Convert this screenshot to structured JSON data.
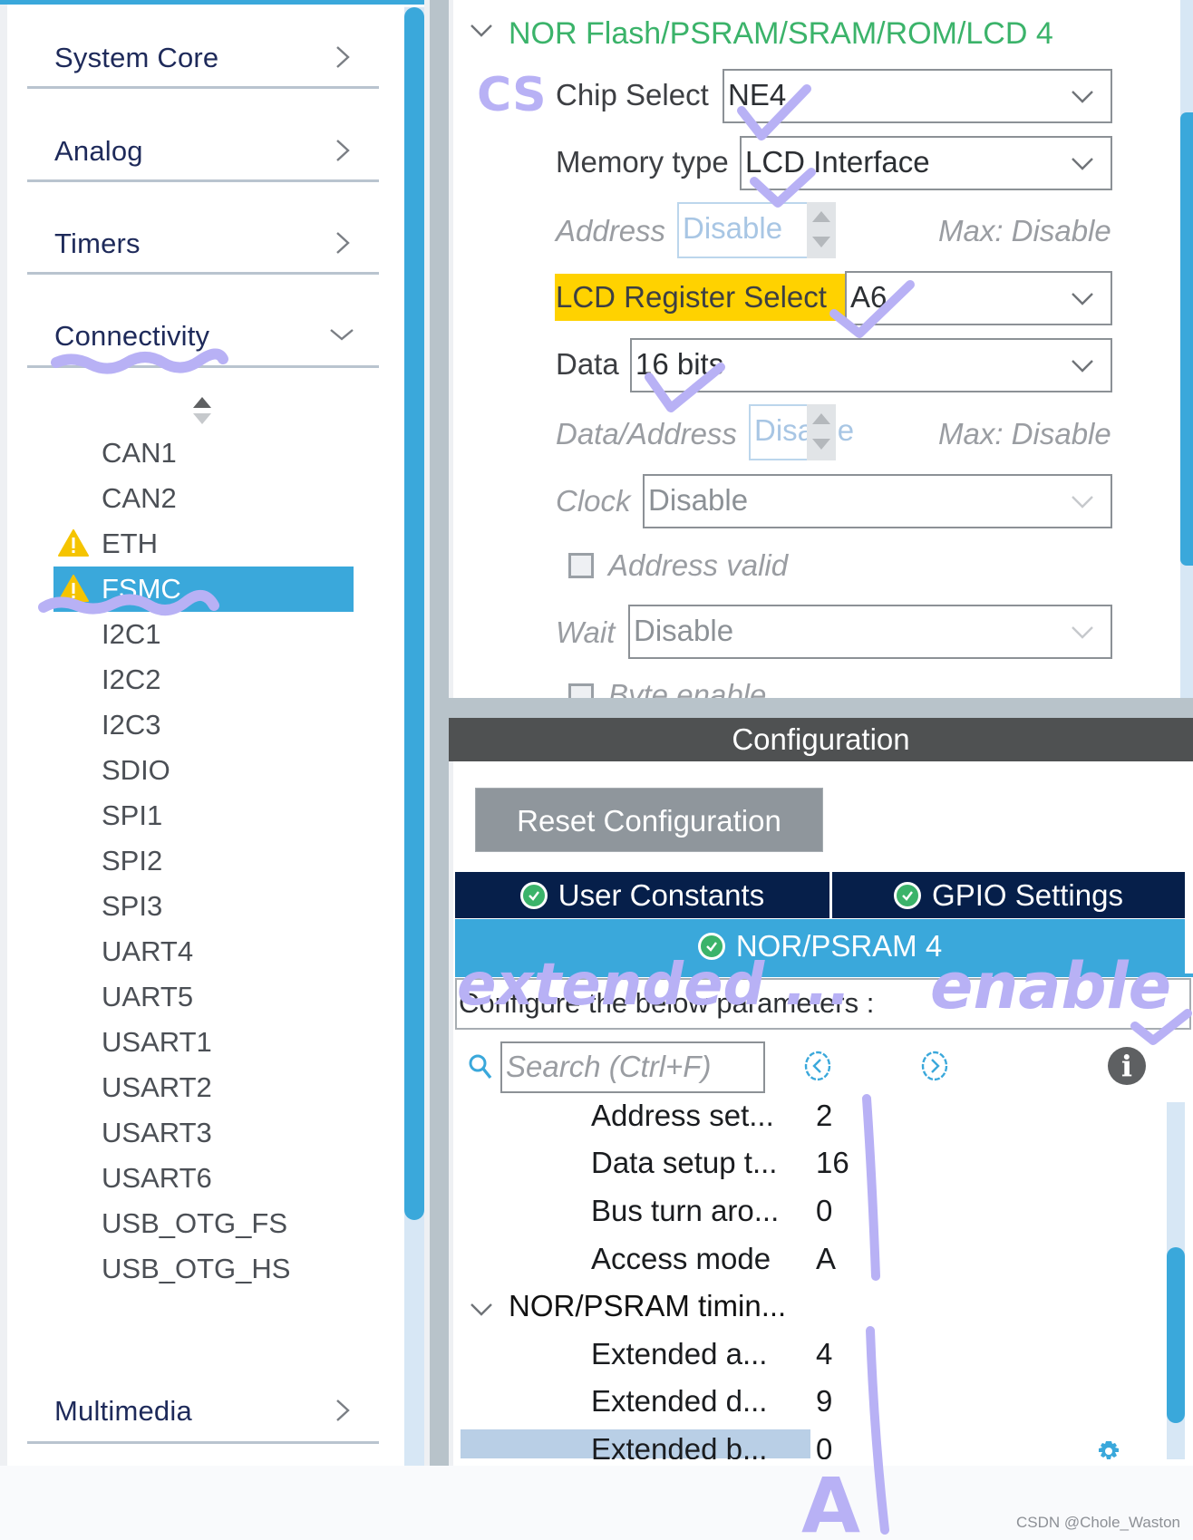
{
  "sidebar": {
    "categories": [
      {
        "label": "System Core",
        "icon": "chevron-right-icon"
      },
      {
        "label": "Analog",
        "icon": "chevron-right-icon"
      },
      {
        "label": "Timers",
        "icon": "chevron-right-icon"
      },
      {
        "label": "Connectivity",
        "icon": "chevron-down-icon",
        "expanded": true
      },
      {
        "label": "Multimedia",
        "icon": "chevron-right-icon"
      }
    ],
    "sort_icon": "sort-arrows-icon",
    "connectivity_items": [
      {
        "label": "CAN1",
        "warning": false
      },
      {
        "label": "CAN2",
        "warning": false
      },
      {
        "label": "ETH",
        "warning": true
      },
      {
        "label": "FSMC",
        "warning": true,
        "selected": true
      },
      {
        "label": "I2C1",
        "warning": false
      },
      {
        "label": "I2C2",
        "warning": false
      },
      {
        "label": "I2C3",
        "warning": false
      },
      {
        "label": "SDIO",
        "warning": false
      },
      {
        "label": "SPI1",
        "warning": false
      },
      {
        "label": "SPI2",
        "warning": false
      },
      {
        "label": "SPI3",
        "warning": false
      },
      {
        "label": "UART4",
        "warning": false
      },
      {
        "label": "UART5",
        "warning": false
      },
      {
        "label": "USART1",
        "warning": false
      },
      {
        "label": "USART2",
        "warning": false
      },
      {
        "label": "USART3",
        "warning": false
      },
      {
        "label": "USART6",
        "warning": false
      },
      {
        "label": "USB_OTG_FS",
        "warning": false
      },
      {
        "label": "USB_OTG_HS",
        "warning": false
      }
    ]
  },
  "mode": {
    "section_title": "NOR Flash/PSRAM/SRAM/ROM/LCD 4",
    "chip_select": {
      "label": "Chip Select",
      "value": "NE4"
    },
    "memory_type": {
      "label": "Memory type",
      "value": "LCD Interface"
    },
    "address": {
      "label": "Address",
      "value": "Disable",
      "max": "Max: Disable"
    },
    "lcd_register_select": {
      "label": "LCD Register Select",
      "value": "A6"
    },
    "data": {
      "label": "Data",
      "value": "16 bits"
    },
    "data_address": {
      "label": "Data/Address",
      "value": "Disable",
      "max": "Max: Disable"
    },
    "clock": {
      "label": "Clock",
      "value": "Disable"
    },
    "address_valid": {
      "label": "Address valid",
      "checked": false
    },
    "wait": {
      "label": "Wait",
      "value": "Disable"
    },
    "byte_enable": {
      "label": "Byte enable",
      "checked": false
    }
  },
  "configuration": {
    "header": "Configuration",
    "reset_button": "Reset Configuration",
    "tabs": [
      {
        "label": "User Constants",
        "status": "ok"
      },
      {
        "label": "GPIO Settings",
        "status": "ok"
      },
      {
        "label": "NOR/PSRAM 4",
        "status": "ok",
        "active": true
      }
    ],
    "configure_text": "Configure the below parameters :",
    "search_placeholder": "Search (Ctrl+F)",
    "parameters": [
      {
        "name": "Address set...",
        "value": "2"
      },
      {
        "name": "Data setup t...",
        "value": "16"
      },
      {
        "name": "Bus turn aro...",
        "value": "0"
      },
      {
        "name": "Access mode",
        "value": "A"
      }
    ],
    "group": {
      "title": "NOR/PSRAM timin...",
      "parameters": [
        {
          "name": "Extended a...",
          "value": "4"
        },
        {
          "name": "Extended d...",
          "value": "9"
        },
        {
          "name": "Extended b...",
          "value": "0"
        }
      ]
    }
  },
  "annotations": {
    "cs": "CS",
    "extended": "extended ...",
    "enable": "enable",
    "mode_a": "A"
  },
  "watermark": "CSDN @Chole_Waston",
  "colors": {
    "accent_blue": "#3aa8db",
    "tab_navy": "#061f4a",
    "section_green": "#3bb36a",
    "highlight_yellow": "#ffd200",
    "warning_yellow": "#f5c400",
    "pen_lavender": "#b8b1f5"
  }
}
